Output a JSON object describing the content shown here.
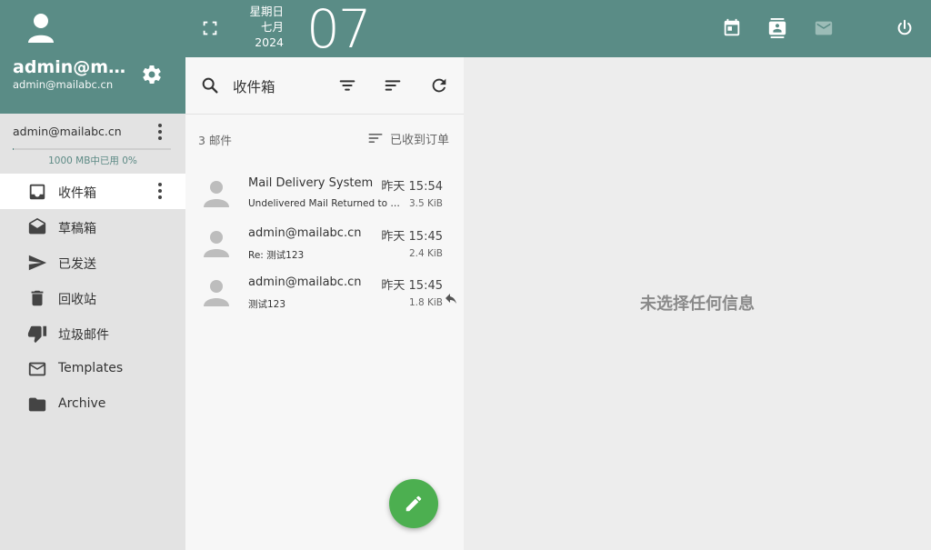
{
  "account": {
    "display_name": "admin@mailabc.cn",
    "email": "admin@mailabc.cn",
    "row_label": "admin@mailabc.cn",
    "quota": "1000 MB中已用 0%",
    "quota_used_fraction": 0
  },
  "folders": [
    {
      "label": "收件箱",
      "icon": "inbox-icon",
      "active": true
    },
    {
      "label": "草稿箱",
      "icon": "drafts-icon",
      "active": false
    },
    {
      "label": "已发送",
      "icon": "send-icon",
      "active": false
    },
    {
      "label": "回收站",
      "icon": "trash-icon",
      "active": false
    },
    {
      "label": "垃圾邮件",
      "icon": "thumb-down-icon",
      "active": false
    },
    {
      "label": "Templates",
      "icon": "envelope-icon",
      "active": false
    },
    {
      "label": "Archive",
      "icon": "folder-icon",
      "active": false
    }
  ],
  "topbar": {
    "weekday": "星期日",
    "month": "七月",
    "year": "2024",
    "day": "07",
    "icons": [
      "expand-icon",
      "calendar-icon",
      "contacts-icon",
      "mail-icon",
      "power-icon"
    ]
  },
  "list": {
    "title": "收件箱",
    "count": "3 邮件",
    "sort_label": "已收到订单",
    "messages": [
      {
        "from": "Mail Delivery System",
        "time": "昨天 15:54",
        "subject": "Undelivered Mail Returned to Sender",
        "size": "3.5 KiB",
        "replied": false
      },
      {
        "from": "admin@mailabc.cn",
        "time": "昨天 15:45",
        "subject": "Re: 测试123",
        "size": "2.4 KiB",
        "replied": false
      },
      {
        "from": "admin@mailabc.cn",
        "time": "昨天 15:45",
        "subject": "测试123",
        "size": "1.8 KiB",
        "replied": true
      }
    ]
  },
  "preview": {
    "empty_text": "未选择任何信息"
  },
  "colors": {
    "header": "#5a8c86",
    "fab": "#4caf50",
    "sidebar": "#e3e3e3"
  }
}
